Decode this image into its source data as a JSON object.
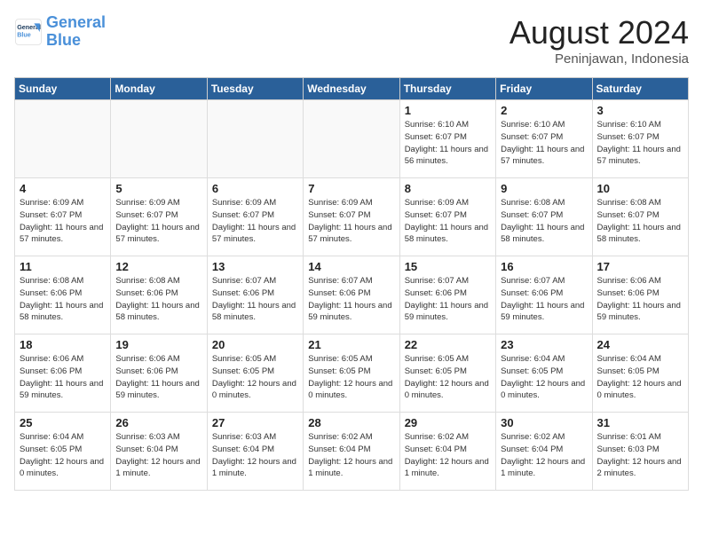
{
  "header": {
    "logo_general": "General",
    "logo_blue": "Blue",
    "month_year": "August 2024",
    "location": "Peninjawan, Indonesia"
  },
  "weekdays": [
    "Sunday",
    "Monday",
    "Tuesday",
    "Wednesday",
    "Thursday",
    "Friday",
    "Saturday"
  ],
  "weeks": [
    [
      {
        "day": "",
        "info": ""
      },
      {
        "day": "",
        "info": ""
      },
      {
        "day": "",
        "info": ""
      },
      {
        "day": "",
        "info": ""
      },
      {
        "day": "1",
        "info": "Sunrise: 6:10 AM\nSunset: 6:07 PM\nDaylight: 11 hours and 56 minutes."
      },
      {
        "day": "2",
        "info": "Sunrise: 6:10 AM\nSunset: 6:07 PM\nDaylight: 11 hours and 57 minutes."
      },
      {
        "day": "3",
        "info": "Sunrise: 6:10 AM\nSunset: 6:07 PM\nDaylight: 11 hours and 57 minutes."
      }
    ],
    [
      {
        "day": "4",
        "info": "Sunrise: 6:09 AM\nSunset: 6:07 PM\nDaylight: 11 hours and 57 minutes."
      },
      {
        "day": "5",
        "info": "Sunrise: 6:09 AM\nSunset: 6:07 PM\nDaylight: 11 hours and 57 minutes."
      },
      {
        "day": "6",
        "info": "Sunrise: 6:09 AM\nSunset: 6:07 PM\nDaylight: 11 hours and 57 minutes."
      },
      {
        "day": "7",
        "info": "Sunrise: 6:09 AM\nSunset: 6:07 PM\nDaylight: 11 hours and 57 minutes."
      },
      {
        "day": "8",
        "info": "Sunrise: 6:09 AM\nSunset: 6:07 PM\nDaylight: 11 hours and 58 minutes."
      },
      {
        "day": "9",
        "info": "Sunrise: 6:08 AM\nSunset: 6:07 PM\nDaylight: 11 hours and 58 minutes."
      },
      {
        "day": "10",
        "info": "Sunrise: 6:08 AM\nSunset: 6:07 PM\nDaylight: 11 hours and 58 minutes."
      }
    ],
    [
      {
        "day": "11",
        "info": "Sunrise: 6:08 AM\nSunset: 6:06 PM\nDaylight: 11 hours and 58 minutes."
      },
      {
        "day": "12",
        "info": "Sunrise: 6:08 AM\nSunset: 6:06 PM\nDaylight: 11 hours and 58 minutes."
      },
      {
        "day": "13",
        "info": "Sunrise: 6:07 AM\nSunset: 6:06 PM\nDaylight: 11 hours and 58 minutes."
      },
      {
        "day": "14",
        "info": "Sunrise: 6:07 AM\nSunset: 6:06 PM\nDaylight: 11 hours and 59 minutes."
      },
      {
        "day": "15",
        "info": "Sunrise: 6:07 AM\nSunset: 6:06 PM\nDaylight: 11 hours and 59 minutes."
      },
      {
        "day": "16",
        "info": "Sunrise: 6:07 AM\nSunset: 6:06 PM\nDaylight: 11 hours and 59 minutes."
      },
      {
        "day": "17",
        "info": "Sunrise: 6:06 AM\nSunset: 6:06 PM\nDaylight: 11 hours and 59 minutes."
      }
    ],
    [
      {
        "day": "18",
        "info": "Sunrise: 6:06 AM\nSunset: 6:06 PM\nDaylight: 11 hours and 59 minutes."
      },
      {
        "day": "19",
        "info": "Sunrise: 6:06 AM\nSunset: 6:06 PM\nDaylight: 11 hours and 59 minutes."
      },
      {
        "day": "20",
        "info": "Sunrise: 6:05 AM\nSunset: 6:05 PM\nDaylight: 12 hours and 0 minutes."
      },
      {
        "day": "21",
        "info": "Sunrise: 6:05 AM\nSunset: 6:05 PM\nDaylight: 12 hours and 0 minutes."
      },
      {
        "day": "22",
        "info": "Sunrise: 6:05 AM\nSunset: 6:05 PM\nDaylight: 12 hours and 0 minutes."
      },
      {
        "day": "23",
        "info": "Sunrise: 6:04 AM\nSunset: 6:05 PM\nDaylight: 12 hours and 0 minutes."
      },
      {
        "day": "24",
        "info": "Sunrise: 6:04 AM\nSunset: 6:05 PM\nDaylight: 12 hours and 0 minutes."
      }
    ],
    [
      {
        "day": "25",
        "info": "Sunrise: 6:04 AM\nSunset: 6:05 PM\nDaylight: 12 hours and 0 minutes."
      },
      {
        "day": "26",
        "info": "Sunrise: 6:03 AM\nSunset: 6:04 PM\nDaylight: 12 hours and 1 minute."
      },
      {
        "day": "27",
        "info": "Sunrise: 6:03 AM\nSunset: 6:04 PM\nDaylight: 12 hours and 1 minute."
      },
      {
        "day": "28",
        "info": "Sunrise: 6:02 AM\nSunset: 6:04 PM\nDaylight: 12 hours and 1 minute."
      },
      {
        "day": "29",
        "info": "Sunrise: 6:02 AM\nSunset: 6:04 PM\nDaylight: 12 hours and 1 minute."
      },
      {
        "day": "30",
        "info": "Sunrise: 6:02 AM\nSunset: 6:04 PM\nDaylight: 12 hours and 1 minute."
      },
      {
        "day": "31",
        "info": "Sunrise: 6:01 AM\nSunset: 6:03 PM\nDaylight: 12 hours and 2 minutes."
      }
    ]
  ]
}
